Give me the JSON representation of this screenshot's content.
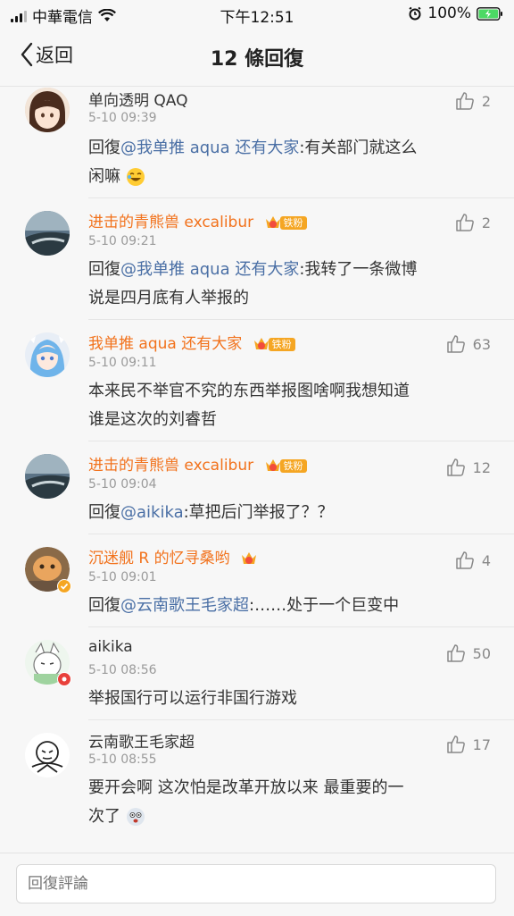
{
  "status_bar": {
    "carrier": "中華電信",
    "time": "下午12:51",
    "battery": "100%"
  },
  "nav": {
    "back_label": "返回",
    "title": "12 條回復"
  },
  "comments": [
    {
      "name": "单向透明 QAQ",
      "name_style": "plain",
      "time": "5-10 09:39",
      "likes": "2",
      "reply_prefix": "回復",
      "mention": "@我单推 aqua 还有大家",
      "text": ":有关部门就这么",
      "text_line2": "闲嘛",
      "emoji": "laughing-emoji"
    },
    {
      "name": "进击的青熊兽 excalibur",
      "name_style": "orange",
      "badge_level": "5",
      "fan_label": "铁粉",
      "time": "5-10 09:21",
      "likes": "2",
      "reply_prefix": "回復",
      "mention": "@我单推 aqua 还有大家",
      "text": ":我转了一条微博",
      "text_line2": "说是四月底有人举报的"
    },
    {
      "name": "我单推 aqua 还有大家",
      "name_style": "orange",
      "badge_level": "5",
      "fan_label": "铁粉",
      "time": "5-10 09:11",
      "likes": "63",
      "text": "本来民不举官不究的东西举报图啥啊我想知道",
      "text_line2": "谁是这次的刘睿哲"
    },
    {
      "name": "进击的青熊兽 excalibur",
      "name_style": "orange",
      "badge_level": "5",
      "fan_label": "铁粉",
      "time": "5-10 09:04",
      "likes": "12",
      "reply_prefix": "回復",
      "mention": "@aikika",
      "text": ":草把后门举报了？？"
    },
    {
      "name": "沉迷舰 R 的忆寻桑哟",
      "name_style": "orange",
      "time": "5-10 09:01",
      "likes": "4",
      "reply_prefix": "回復",
      "mention": "@云南歌王毛家超",
      "text": ":……处于一个巨变中"
    },
    {
      "name": "aikika",
      "name_style": "plain",
      "time": "5-10 08:56",
      "likes": "50",
      "text": "举报国行可以运行非国行游戏"
    },
    {
      "name": "云南歌王毛家超",
      "name_style": "plain",
      "time": "5-10 08:55",
      "likes": "17",
      "text": "要开会啊 这次怕是改革开放以来 最重要的一",
      "text_line2": "次了",
      "emoji": "shocked-emoji"
    }
  ],
  "input": {
    "placeholder": "回復評論"
  },
  "colors": {
    "orange_name": "#f2721c",
    "mention": "#4a6fa5",
    "badge": "#f5a623"
  }
}
